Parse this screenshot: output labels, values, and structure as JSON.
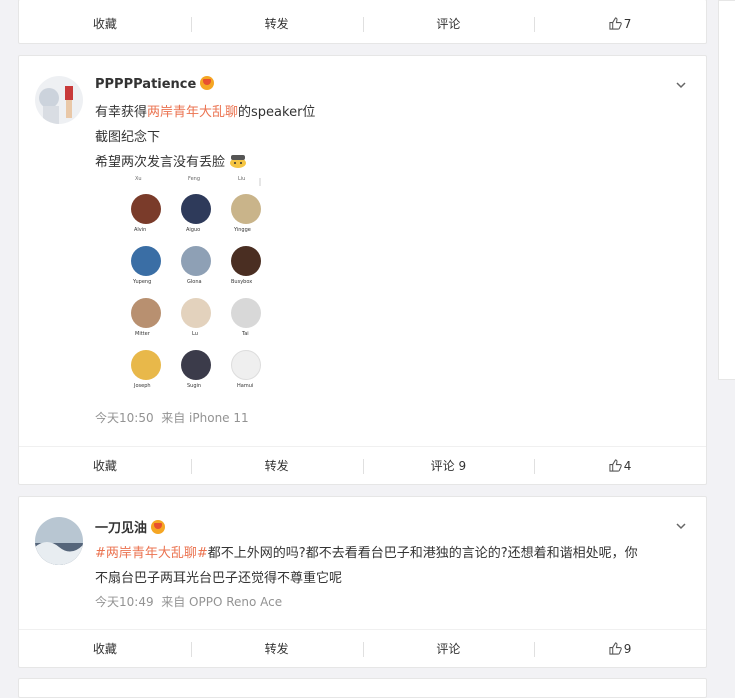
{
  "top_card": {
    "actions": {
      "favorite": "收藏",
      "repost": "转发",
      "comment": "评论",
      "like_count": "7"
    }
  },
  "post1": {
    "username": "PPPPPatience",
    "line1_prefix": "有幸获得",
    "line1_topic": "两岸青年大乱聊",
    "line1_suffix": "的speaker位",
    "line2": "截图纪念下",
    "line3": "希望两次发言没有丢脸",
    "grid_top_labels": [
      "Xu",
      "Feng",
      "Liu"
    ],
    "grid_names": [
      "Alvin",
      "Aiguo",
      "Yingge",
      "Yupeng",
      "Glona",
      "Busybox",
      "Mitter",
      "Lu",
      "Tai",
      "Joseph",
      "Sugin",
      "Hamui"
    ],
    "time": "今天10:50",
    "source": "来自 iPhone 11",
    "actions": {
      "favorite": "收藏",
      "repost": "转发",
      "comment": "评论 9",
      "like_count": "4"
    }
  },
  "post2": {
    "username": "一刀见油",
    "line1_topic": "#两岸青年大乱聊#",
    "line1_rest": "都不上外网的吗?都不去看看台巴子和港独的言论的?还想着和谐相处呢，你",
    "line2": "不扇台巴子两耳光台巴子还觉得不尊重它呢",
    "time": "今天10:49",
    "source": "来自 OPPO Reno Ace",
    "actions": {
      "favorite": "收藏",
      "repost": "转发",
      "comment": "评论",
      "like_count": "9"
    }
  },
  "colors": {
    "topic": "#eb7350",
    "meta": "#939393",
    "background": "#f2f2f5"
  }
}
